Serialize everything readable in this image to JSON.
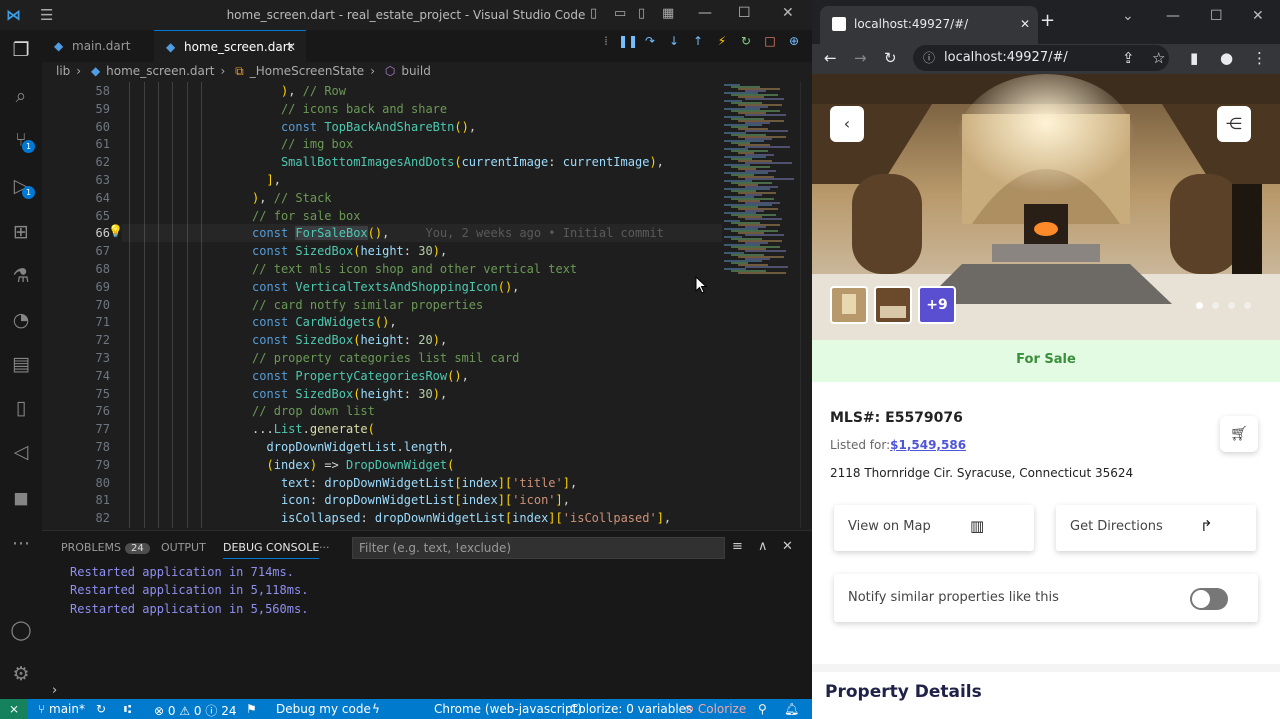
{
  "vscode": {
    "window_title": "home_screen.dart - real_estate_project - Visual Studio Code",
    "tabs": [
      {
        "label": "main.dart",
        "active": false
      },
      {
        "label": "home_screen.dart",
        "active": true
      }
    ],
    "breadcrumb": [
      "lib",
      "home_screen.dart",
      "_HomeScreenState",
      "build"
    ],
    "line_numbers": [
      "58",
      "59",
      "60",
      "61",
      "62",
      "63",
      "64",
      "65",
      "66",
      "67",
      "68",
      "69",
      "70",
      "71",
      "72",
      "73",
      "74",
      "75",
      "76",
      "77",
      "78",
      "79",
      "80",
      "81",
      "82"
    ],
    "code_lines": [
      "), // Row",
      "// icons back and share",
      "const TopBackAndShareBtn(),",
      "// img box",
      "SmallBottomImagesAndDots(currentImage: currentImage),",
      "],",
      "), // Stack",
      "// for sale box",
      "const ForSaleBox(),",
      "const SizedBox(height: 30),",
      "// text mls icon shop and other vertical text",
      "const VerticalTextsAndShoppingIcon(),",
      "// card notfy similar properties",
      "const CardWidgets(),",
      "const SizedBox(height: 20),",
      "// property categories list smil card",
      "const PropertyCategoriesRow(),",
      "const SizedBox(height: 30),",
      "// drop down list",
      "...List.generate(",
      "dropDownWidgetList.length,",
      "(index) => DropDownWidget(",
      "text: dropDownWidgetList[index]['title'],",
      "icon: dropDownWidgetList[index]['icon'],",
      "isCollapsed: dropDownWidgetList[index]['isCollpased'],"
    ],
    "blame": "You, 2 weeks ago • Initial commit",
    "panel": {
      "tabs": [
        {
          "label": "PROBLEMS",
          "badge": "24"
        },
        {
          "label": "OUTPUT"
        },
        {
          "label": "DEBUG CONSOLE",
          "active": true
        },
        {
          "label": "···"
        }
      ],
      "filter_placeholder": "Filter (e.g. text, !exclude)",
      "output": [
        "Restarted application in 714ms.",
        "Restarted application in 5,118ms.",
        "Restarted application in 5,560ms."
      ]
    },
    "status": {
      "branch": "main*",
      "errors": "0",
      "warnings": "0",
      "info": "24",
      "debug": "Debug my code",
      "device": "Chrome (web-javascript)",
      "colorize_vars": "Colorize: 0 variables",
      "colorize": "Colorize"
    },
    "colors": {
      "accent": "#007acc",
      "bg": "#1e1e1e"
    }
  },
  "browser": {
    "tab_title": "localhost:49927/#/",
    "url": "localhost:49927/#/",
    "app": {
      "thumb_more": "+9",
      "for_sale": "For Sale",
      "mls": "MLS#: E5579076",
      "listed_label": "Listed for:",
      "price": "$1,549,586",
      "address": "2118 Thornridge Cir. Syracuse, Connecticut 35624",
      "view_on_map": "View on Map",
      "get_directions": "Get Directions",
      "notify": "Notify similar properties like this",
      "notify_enabled": false,
      "section_title": "Property Details",
      "carousel_active_index": 0,
      "carousel_count": 4
    }
  }
}
